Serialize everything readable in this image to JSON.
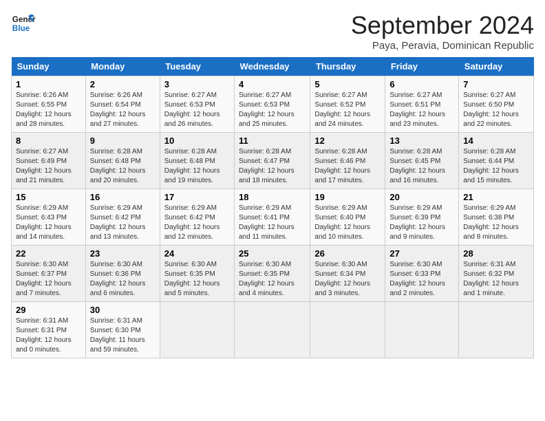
{
  "header": {
    "logo_line1": "General",
    "logo_line2": "Blue",
    "month": "September 2024",
    "location": "Paya, Peravia, Dominican Republic"
  },
  "days_of_week": [
    "Sunday",
    "Monday",
    "Tuesday",
    "Wednesday",
    "Thursday",
    "Friday",
    "Saturday"
  ],
  "weeks": [
    [
      {
        "day": "1",
        "info": "Sunrise: 6:26 AM\nSunset: 6:55 PM\nDaylight: 12 hours\nand 28 minutes."
      },
      {
        "day": "2",
        "info": "Sunrise: 6:26 AM\nSunset: 6:54 PM\nDaylight: 12 hours\nand 27 minutes."
      },
      {
        "day": "3",
        "info": "Sunrise: 6:27 AM\nSunset: 6:53 PM\nDaylight: 12 hours\nand 26 minutes."
      },
      {
        "day": "4",
        "info": "Sunrise: 6:27 AM\nSunset: 6:53 PM\nDaylight: 12 hours\nand 25 minutes."
      },
      {
        "day": "5",
        "info": "Sunrise: 6:27 AM\nSunset: 6:52 PM\nDaylight: 12 hours\nand 24 minutes."
      },
      {
        "day": "6",
        "info": "Sunrise: 6:27 AM\nSunset: 6:51 PM\nDaylight: 12 hours\nand 23 minutes."
      },
      {
        "day": "7",
        "info": "Sunrise: 6:27 AM\nSunset: 6:50 PM\nDaylight: 12 hours\nand 22 minutes."
      }
    ],
    [
      {
        "day": "8",
        "info": "Sunrise: 6:27 AM\nSunset: 6:49 PM\nDaylight: 12 hours\nand 21 minutes."
      },
      {
        "day": "9",
        "info": "Sunrise: 6:28 AM\nSunset: 6:48 PM\nDaylight: 12 hours\nand 20 minutes."
      },
      {
        "day": "10",
        "info": "Sunrise: 6:28 AM\nSunset: 6:48 PM\nDaylight: 12 hours\nand 19 minutes."
      },
      {
        "day": "11",
        "info": "Sunrise: 6:28 AM\nSunset: 6:47 PM\nDaylight: 12 hours\nand 18 minutes."
      },
      {
        "day": "12",
        "info": "Sunrise: 6:28 AM\nSunset: 6:46 PM\nDaylight: 12 hours\nand 17 minutes."
      },
      {
        "day": "13",
        "info": "Sunrise: 6:28 AM\nSunset: 6:45 PM\nDaylight: 12 hours\nand 16 minutes."
      },
      {
        "day": "14",
        "info": "Sunrise: 6:28 AM\nSunset: 6:44 PM\nDaylight: 12 hours\nand 15 minutes."
      }
    ],
    [
      {
        "day": "15",
        "info": "Sunrise: 6:29 AM\nSunset: 6:43 PM\nDaylight: 12 hours\nand 14 minutes."
      },
      {
        "day": "16",
        "info": "Sunrise: 6:29 AM\nSunset: 6:42 PM\nDaylight: 12 hours\nand 13 minutes."
      },
      {
        "day": "17",
        "info": "Sunrise: 6:29 AM\nSunset: 6:42 PM\nDaylight: 12 hours\nand 12 minutes."
      },
      {
        "day": "18",
        "info": "Sunrise: 6:29 AM\nSunset: 6:41 PM\nDaylight: 12 hours\nand 11 minutes."
      },
      {
        "day": "19",
        "info": "Sunrise: 6:29 AM\nSunset: 6:40 PM\nDaylight: 12 hours\nand 10 minutes."
      },
      {
        "day": "20",
        "info": "Sunrise: 6:29 AM\nSunset: 6:39 PM\nDaylight: 12 hours\nand 9 minutes."
      },
      {
        "day": "21",
        "info": "Sunrise: 6:29 AM\nSunset: 6:38 PM\nDaylight: 12 hours\nand 8 minutes."
      }
    ],
    [
      {
        "day": "22",
        "info": "Sunrise: 6:30 AM\nSunset: 6:37 PM\nDaylight: 12 hours\nand 7 minutes."
      },
      {
        "day": "23",
        "info": "Sunrise: 6:30 AM\nSunset: 6:36 PM\nDaylight: 12 hours\nand 6 minutes."
      },
      {
        "day": "24",
        "info": "Sunrise: 6:30 AM\nSunset: 6:35 PM\nDaylight: 12 hours\nand 5 minutes."
      },
      {
        "day": "25",
        "info": "Sunrise: 6:30 AM\nSunset: 6:35 PM\nDaylight: 12 hours\nand 4 minutes."
      },
      {
        "day": "26",
        "info": "Sunrise: 6:30 AM\nSunset: 6:34 PM\nDaylight: 12 hours\nand 3 minutes."
      },
      {
        "day": "27",
        "info": "Sunrise: 6:30 AM\nSunset: 6:33 PM\nDaylight: 12 hours\nand 2 minutes."
      },
      {
        "day": "28",
        "info": "Sunrise: 6:31 AM\nSunset: 6:32 PM\nDaylight: 12 hours\nand 1 minute."
      }
    ],
    [
      {
        "day": "29",
        "info": "Sunrise: 6:31 AM\nSunset: 6:31 PM\nDaylight: 12 hours\nand 0 minutes."
      },
      {
        "day": "30",
        "info": "Sunrise: 6:31 AM\nSunset: 6:30 PM\nDaylight: 11 hours\nand 59 minutes."
      },
      {
        "day": "",
        "info": ""
      },
      {
        "day": "",
        "info": ""
      },
      {
        "day": "",
        "info": ""
      },
      {
        "day": "",
        "info": ""
      },
      {
        "day": "",
        "info": ""
      }
    ]
  ]
}
